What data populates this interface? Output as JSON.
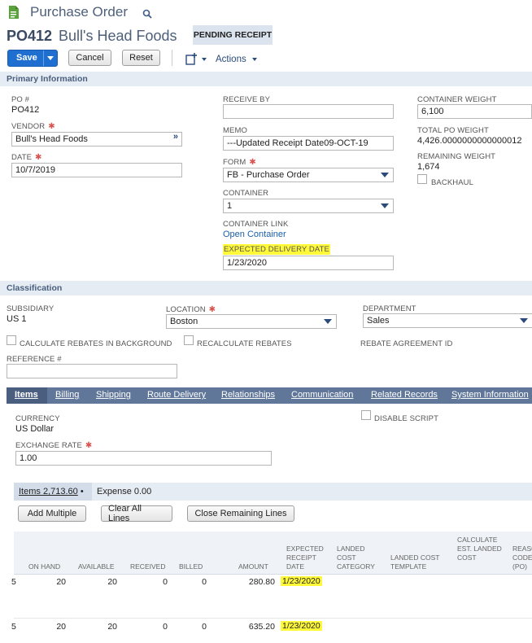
{
  "header": {
    "title": "Purchase Order",
    "record_number": "PO412",
    "vendor_name": "Bull's Head Foods",
    "status": "PENDING RECEIPT"
  },
  "toolbar": {
    "save_label": "Save",
    "cancel_label": "Cancel",
    "reset_label": "Reset",
    "actions_label": "Actions"
  },
  "primary": {
    "section_title": "Primary Information",
    "po_label": "PO #",
    "po_value": "PO412",
    "vendor_label": "VENDOR",
    "vendor_value": "Bull's Head Foods",
    "date_label": "DATE",
    "date_value": "10/7/2019",
    "receive_by_label": "RECEIVE BY",
    "receive_by_value": "",
    "memo_label": "MEMO",
    "memo_value": "---Updated Receipt Date09-OCT-19",
    "form_label": "FORM",
    "form_value": "FB - Purchase Order",
    "container_label": "CONTAINER",
    "container_value": "1",
    "container_link_label": "CONTAINER LINK",
    "container_link_value": "Open Container",
    "expected_delivery_label": "EXPECTED DELIVERY DATE",
    "expected_delivery_value": "1/23/2020",
    "container_weight_label": "CONTAINER WEIGHT",
    "container_weight_value": "6,100",
    "total_po_weight_label": "TOTAL PO WEIGHT",
    "total_po_weight_value": "4,426.0000000000000012",
    "remaining_weight_label": "REMAINING WEIGHT",
    "remaining_weight_value": "1,674",
    "backhaul_label": "BACKHAUL"
  },
  "classification": {
    "section_title": "Classification",
    "subsidiary_label": "SUBSIDIARY",
    "subsidiary_value": "US 1",
    "location_label": "LOCATION",
    "location_value": "Boston",
    "department_label": "DEPARTMENT",
    "department_value": "Sales",
    "calc_rebates_label": "CALCULATE REBATES IN BACKGROUND",
    "recalc_rebates_label": "RECALCULATE REBATES",
    "rebate_agreement_label": "REBATE AGREEMENT ID",
    "reference_label": "REFERENCE #",
    "reference_value": ""
  },
  "tabs": [
    "Items",
    "Billing",
    "Shipping",
    "Route Delivery",
    "Relationships",
    "Communication",
    "Related Records",
    "System Information"
  ],
  "items_tab": {
    "currency_label": "CURRENCY",
    "currency_value": "US Dollar",
    "exchange_rate_label": "EXCHANGE RATE",
    "exchange_rate_value": "1.00",
    "disable_script_label": "DISABLE SCRIPT",
    "subtab_items": "Items 2,713.60",
    "subtab_expense": "Expense 0.00",
    "add_multiple_label": "Add Multiple",
    "clear_all_label": "Clear All Lines",
    "close_remaining_label": "Close Remaining Lines"
  },
  "table": {
    "headers": {
      "on_hand": "ON HAND",
      "available": "AVAILABLE",
      "received": "RECEIVED",
      "billed": "BILLED",
      "amount": "AMOUNT",
      "expected_receipt_date": "EXPECTED RECEIPT DATE",
      "landed_cost_category": "LANDED COST CATEGORY",
      "landed_cost_template": "LANDED COST TEMPLATE",
      "calculate_est_landed_cost": "CALCULATE EST. LANDED COST",
      "reason_code": "REASO CODE (PO)"
    },
    "rows": [
      {
        "lead": "5",
        "on_hand": "20",
        "available": "20",
        "received": "0",
        "billed": "0",
        "amount": "280.80",
        "expected_receipt_date": "1/23/2020"
      },
      {
        "lead": "5",
        "on_hand": "20",
        "available": "20",
        "received": "0",
        "billed": "0",
        "amount": "635.20",
        "expected_receipt_date": "1/23/2020"
      }
    ]
  },
  "colors": {
    "accent": "#607799",
    "save_button": "#1f6fd0",
    "highlight": "#fff93a",
    "section_bg": "#e6ecf4"
  }
}
